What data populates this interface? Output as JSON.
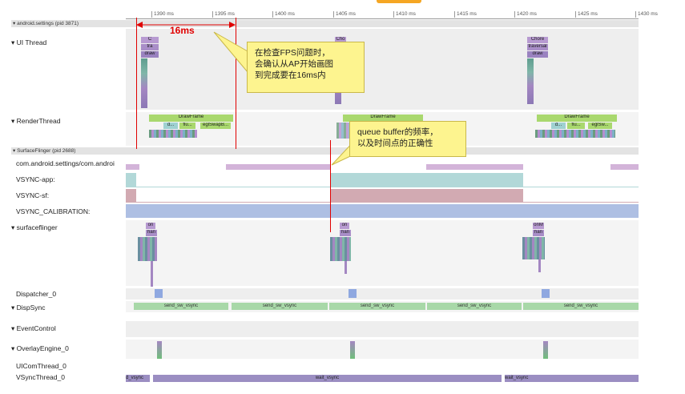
{
  "ruler": {
    "ticks": [
      "1390 ms",
      "1395 ms",
      "1400 ms",
      "1405 ms",
      "1410 ms",
      "1415 ms",
      "1420 ms",
      "1425 ms",
      "1430 ms"
    ]
  },
  "processes": {
    "android_settings": "▾ android.settings (pid 3871)",
    "surfaceflinger": "▾ SurfaceFlinger (pid 2688)"
  },
  "tracks": {
    "ui_thread": "▾ UI Thread",
    "render_thread": "▾ RenderThread",
    "settings_layer": "com.android.settings/com.androi",
    "vsync_app": "VSYNC-app:",
    "vsync_sf": "VSYNC-sf:",
    "vsync_calibration": "VSYNC_CALIBRATION:",
    "surfaceflinger": "▾ surfaceflinger",
    "dispatcher": "Dispatcher_0",
    "dispsync": "▾ DispSync",
    "eventcontrol": "▾ EventControl",
    "overlayengine": "▾ OverlayEngine_0",
    "uicompthread": "UIComThread_0",
    "vsyncthread": "VSyncThread_0"
  },
  "slices": {
    "ui_frame1": [
      "C",
      "tra",
      "draw"
    ],
    "ui_frame2": [
      "Cho",
      "tra"
    ],
    "ui_frame3": [
      "Chore",
      "traversal",
      "draw"
    ],
    "drawframe": "DrawFrame",
    "render_sub": [
      "d...",
      "flu...",
      "eglSwapB..."
    ],
    "render_sub3": [
      "d...",
      "flu...",
      "eglSw..."
    ],
    "sf_slices": [
      "on",
      "han"
    ],
    "sf_slices3": [
      "onM",
      "han"
    ],
    "send_sw_vsync": "send_sw_vsync",
    "wait_vsync": "wait_vsync",
    "wait_vsync_edge": "d_vsync"
  },
  "annotations": {
    "interval_label": "16ms",
    "callout_fps_lines": [
      "在检查FPS问题时，",
      "会确认从AP开始画图",
      "到完成要在16ms内"
    ],
    "callout_queue_lines": [
      "queue buffer的频率，",
      "以及时间点的正确性"
    ]
  },
  "colors": {
    "highlight_red": "#e00000",
    "callout_yellow": "#fdf48f",
    "title_orange": "#f5a623",
    "drawframe_green": "#a9d86e",
    "vsync_app_teal": "#b2d8d8",
    "vsync_sf_rose": "#d2aab2",
    "vsync_cal_blue": "#aebfe3",
    "layer_lilac": "#d3b4d9",
    "dispsync_green": "#a8d8a8",
    "vsyncthread_purple": "#9b8ec2"
  }
}
